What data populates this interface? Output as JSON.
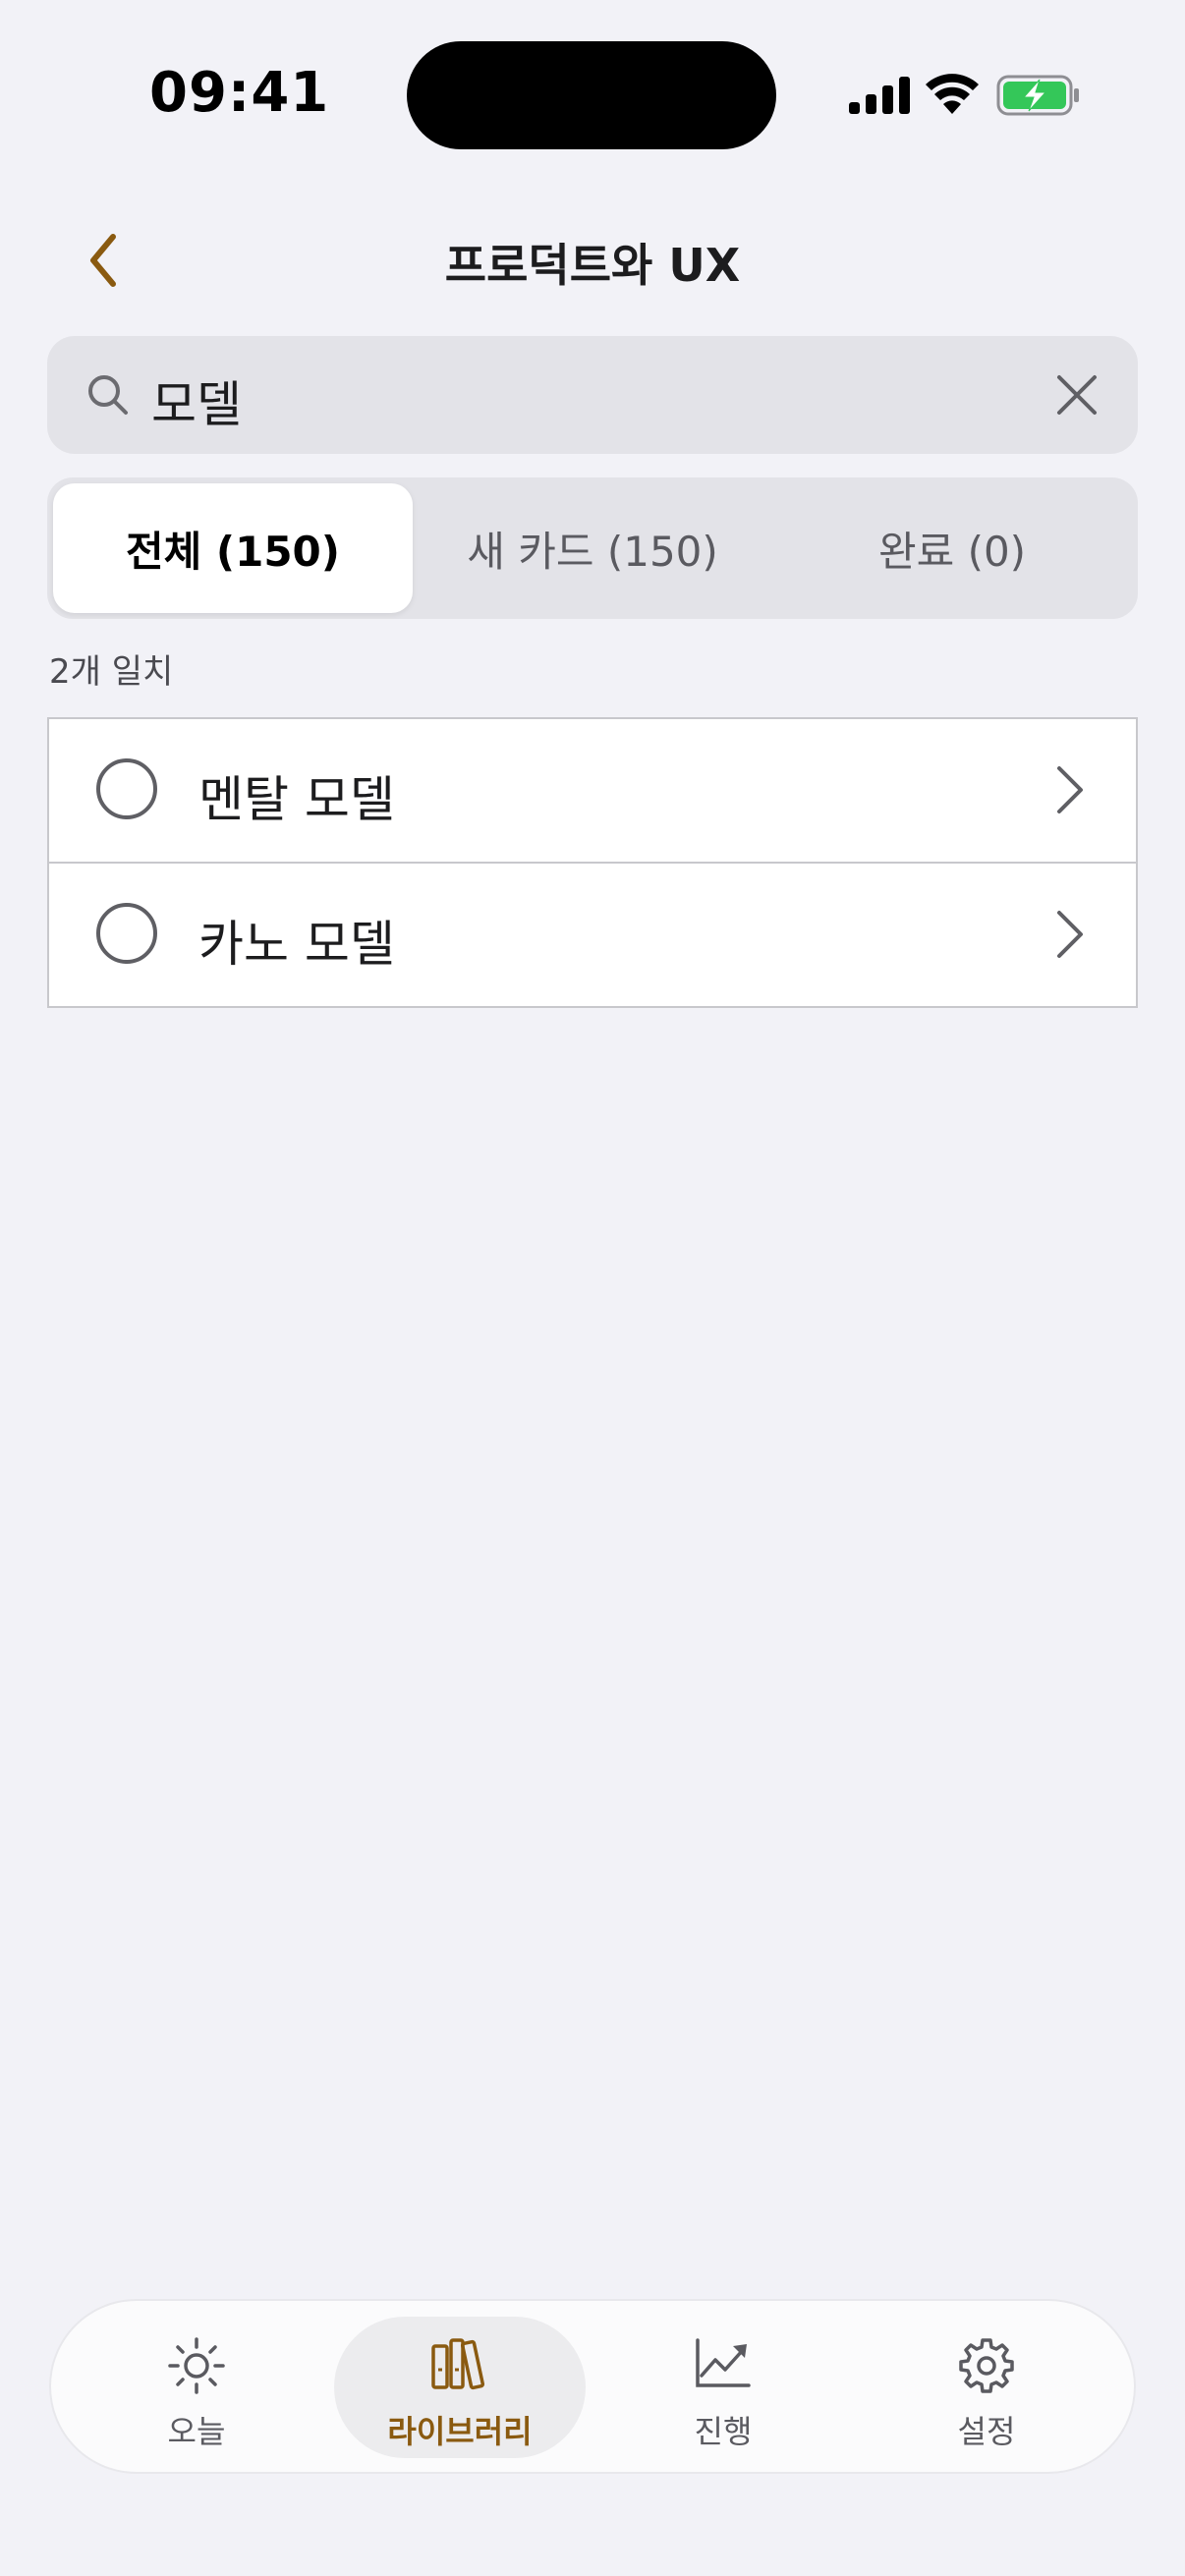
{
  "status_bar": {
    "time": "09:41"
  },
  "nav": {
    "title": "프로덕트와 UX",
    "back_icon": "chevron-left-icon"
  },
  "search": {
    "value": "모델",
    "icon": "search-icon",
    "clear_icon": "close-icon"
  },
  "segments": [
    {
      "label": "전체 (150)",
      "active": true
    },
    {
      "label": "새 카드 (150)",
      "active": false
    },
    {
      "label": "완료 (0)",
      "active": false
    }
  ],
  "match_count": "2개 일치",
  "results": [
    {
      "label": "멘탈 모델"
    },
    {
      "label": "카노 모델"
    }
  ],
  "tab_bar": {
    "items": [
      {
        "label": "오늘",
        "icon": "sun-icon",
        "active": false
      },
      {
        "label": "라이브러리",
        "icon": "books-icon",
        "active": true
      },
      {
        "label": "진행",
        "icon": "chart-line-icon",
        "active": false
      },
      {
        "label": "설정",
        "icon": "gear-icon",
        "active": false
      }
    ]
  },
  "colors": {
    "background": "#f2f2f7",
    "accent": "#8a5a10",
    "battery_green": "#34c759"
  }
}
